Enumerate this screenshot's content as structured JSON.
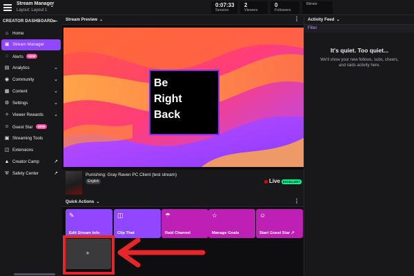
{
  "header": {
    "app_title": "Stream Manager",
    "layout_label": "Layout: Layout 1",
    "stats": [
      {
        "value": "0:07:33",
        "label": "Session"
      },
      {
        "value": "2",
        "label": "Viewers"
      },
      {
        "value": "0",
        "label": "Followers"
      },
      {
        "value": "",
        "label": "Bitrate"
      }
    ]
  },
  "sidebar": {
    "heading": "CREATOR DASHBOARD",
    "new_badge": "NEW",
    "items": [
      {
        "label": "Home",
        "icon": "home-icon"
      },
      {
        "label": "Stream Manager",
        "icon": "stream-manager-icon"
      },
      {
        "label": "Alerts",
        "icon": "alerts-icon"
      },
      {
        "label": "Analytics",
        "icon": "analytics-icon"
      },
      {
        "label": "Community",
        "icon": "community-icon"
      },
      {
        "label": "Content",
        "icon": "content-icon"
      },
      {
        "label": "Settings",
        "icon": "settings-icon"
      },
      {
        "label": "Viewer Rewards",
        "icon": "viewer-rewards-icon"
      },
      {
        "label": "Guest Star",
        "icon": "guest-star-icon"
      },
      {
        "label": "Streaming Tools",
        "icon": "streaming-tools-icon"
      },
      {
        "label": "Extensions",
        "icon": "extensions-icon"
      },
      {
        "label": "Creator Camp",
        "icon": "creator-camp-icon"
      },
      {
        "label": "Safety Center",
        "icon": "safety-center-icon"
      }
    ]
  },
  "preview": {
    "panel_title": "Stream Preview",
    "brb_lines": [
      "Be",
      "Right",
      "Back"
    ]
  },
  "stream_info": {
    "game_title": "Punishing: Gray Raven PC Client (test stream)",
    "language": "English",
    "live_label": "Live",
    "quality_label": "EXCELLENT"
  },
  "quick_actions": {
    "panel_title": "Quick Actions",
    "add_label": "+",
    "buttons": [
      {
        "label": "Edit Stream Info",
        "color": "#9147ff",
        "icon": "pencil-icon"
      },
      {
        "label": "Clip That",
        "color": "#9147ff",
        "icon": "clip-icon"
      },
      {
        "label": "Raid Channel",
        "color": "#be1fb4",
        "icon": "raid-icon"
      },
      {
        "label": "Manage Goals",
        "color": "#be1fb4",
        "icon": "star-icon"
      },
      {
        "label": "Start Guest Star ↗",
        "color": "#be1fb4",
        "icon": "guest-star-icon"
      }
    ]
  },
  "activity_feed": {
    "panel_title": "Activity Feed",
    "filter_label": "Filter",
    "empty_title": "It's quiet. Too quiet...",
    "empty_message": "We'll show your new follows, subs, cheers, and raids activity here."
  },
  "colors": {
    "accent": "#9147ff",
    "magenta": "#be1fb4",
    "annotation_red": "#e8262a",
    "live_red": "#eb0400"
  }
}
